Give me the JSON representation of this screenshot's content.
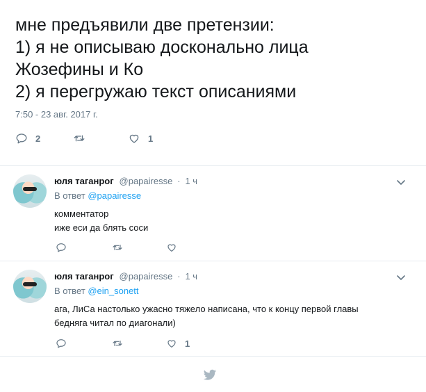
{
  "main_tweet": {
    "lines": [
      "мне предъявили две претензии:",
      "1) я не описываю досконально лица",
      "Жозефины и Ко",
      "2) я перегружаю текст описаниями"
    ],
    "timestamp": "7:50 - 23 авг. 2017 г.",
    "reply_count": "2",
    "retweet_count": "",
    "like_count": "1"
  },
  "replies": [
    {
      "name": "юля таганрог",
      "handle": "@papairesse",
      "sep": "·",
      "time": "1 ч",
      "reply_prefix": "В ответ",
      "reply_to": "@papairesse",
      "text_lines": [
        "комментатор",
        "иже еси да блять соси"
      ],
      "like_count": ""
    },
    {
      "name": "юля таганрог",
      "handle": "@papairesse",
      "sep": "·",
      "time": "1 ч",
      "reply_prefix": "В ответ",
      "reply_to": "@ein_sonett",
      "text_lines": [
        "ага, ЛиСа настолько ужасно тяжело написана, что к концу первой главы",
        "бедняга читал по диагонали)"
      ],
      "like_count": "1"
    }
  ],
  "colors": {
    "text": "#14171a",
    "muted": "#657786",
    "link": "#1da1f2",
    "divider": "#e6ecf0",
    "logo": "#aab8c2"
  },
  "icons": [
    "reply-icon",
    "retweet-icon",
    "like-icon",
    "chevron-down-icon",
    "twitter-bird-icon"
  ]
}
